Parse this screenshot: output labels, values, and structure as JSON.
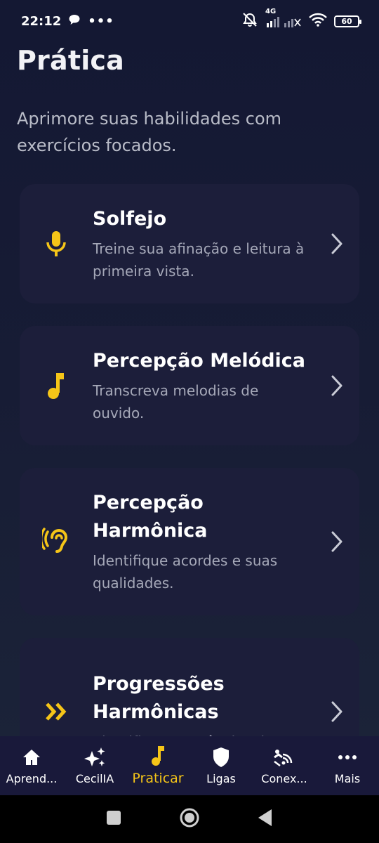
{
  "status_bar": {
    "time": "22:12",
    "dots": "•••",
    "network": "4G",
    "battery": "60"
  },
  "header": {
    "title": "Prática",
    "subtitle": "Aprimore suas habilidades com exercícios focados."
  },
  "cards": [
    {
      "title": "Solfejo",
      "description": "Treine sua afinação e leitura à primeira vista.",
      "icon": "microphone-icon"
    },
    {
      "title": "Percepção Melódica",
      "description": "Transcreva melodias de ouvido.",
      "icon": "music-note-icon"
    },
    {
      "title": "Percepção Harmônica",
      "description": "Identifique acordes e suas qualidades.",
      "icon": "hearing-icon"
    },
    {
      "title": "Progressões Harmônicas",
      "description": "Identifique sequências de",
      "icon": "double-chevron-right-icon"
    }
  ],
  "bottom_nav": [
    {
      "label": "Aprend...",
      "icon": "home-icon",
      "active": false
    },
    {
      "label": "CecilIA",
      "icon": "sparkles-icon",
      "active": false
    },
    {
      "label": "Praticar",
      "icon": "music-note-icon",
      "active": true
    },
    {
      "label": "Ligas",
      "icon": "shield-icon",
      "active": false
    },
    {
      "label": "Conex...",
      "icon": "connections-icon",
      "active": false
    },
    {
      "label": "Mais",
      "icon": "more-icon",
      "active": false
    }
  ],
  "colors": {
    "accent": "#f5c518",
    "background": "#151936",
    "card": "#1c1e3a",
    "nav": "#19193a"
  }
}
